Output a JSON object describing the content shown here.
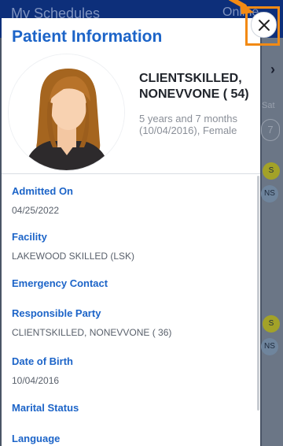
{
  "background": {
    "title": "My Schedules",
    "status": "Online",
    "chevron": "›",
    "day_of_week": "Sat",
    "day_number": "7",
    "badges_top": [
      "S",
      "NS"
    ],
    "badges_bottom": [
      "S",
      "NS"
    ]
  },
  "close_button": {
    "label": "×",
    "icon": "close-icon",
    "highlight_color": "#f28a14"
  },
  "panel": {
    "title": "Patient Information",
    "patient": {
      "name": "CLIENTSKILLED, NONEVVONE ( 54)",
      "age_line": "5 years and 7 months (10/04/2016), Female"
    },
    "fields": [
      {
        "label": "Admitted On",
        "value": "04/25/2022"
      },
      {
        "label": "Facility",
        "value": "LAKEWOOD SKILLED (LSK)"
      },
      {
        "label": "Emergency Contact",
        "value": ""
      },
      {
        "label": "Responsible Party",
        "value": "CLIENTSKILLED, NONEVVONE ( 36)"
      },
      {
        "label": "Date of Birth",
        "value": "10/04/2016"
      },
      {
        "label": "Marital Status",
        "value": ""
      },
      {
        "label": "Language",
        "value": ""
      }
    ]
  },
  "colors": {
    "accent": "#1c64c8",
    "header": "#0d2f7a",
    "highlight": "#f28a14"
  }
}
